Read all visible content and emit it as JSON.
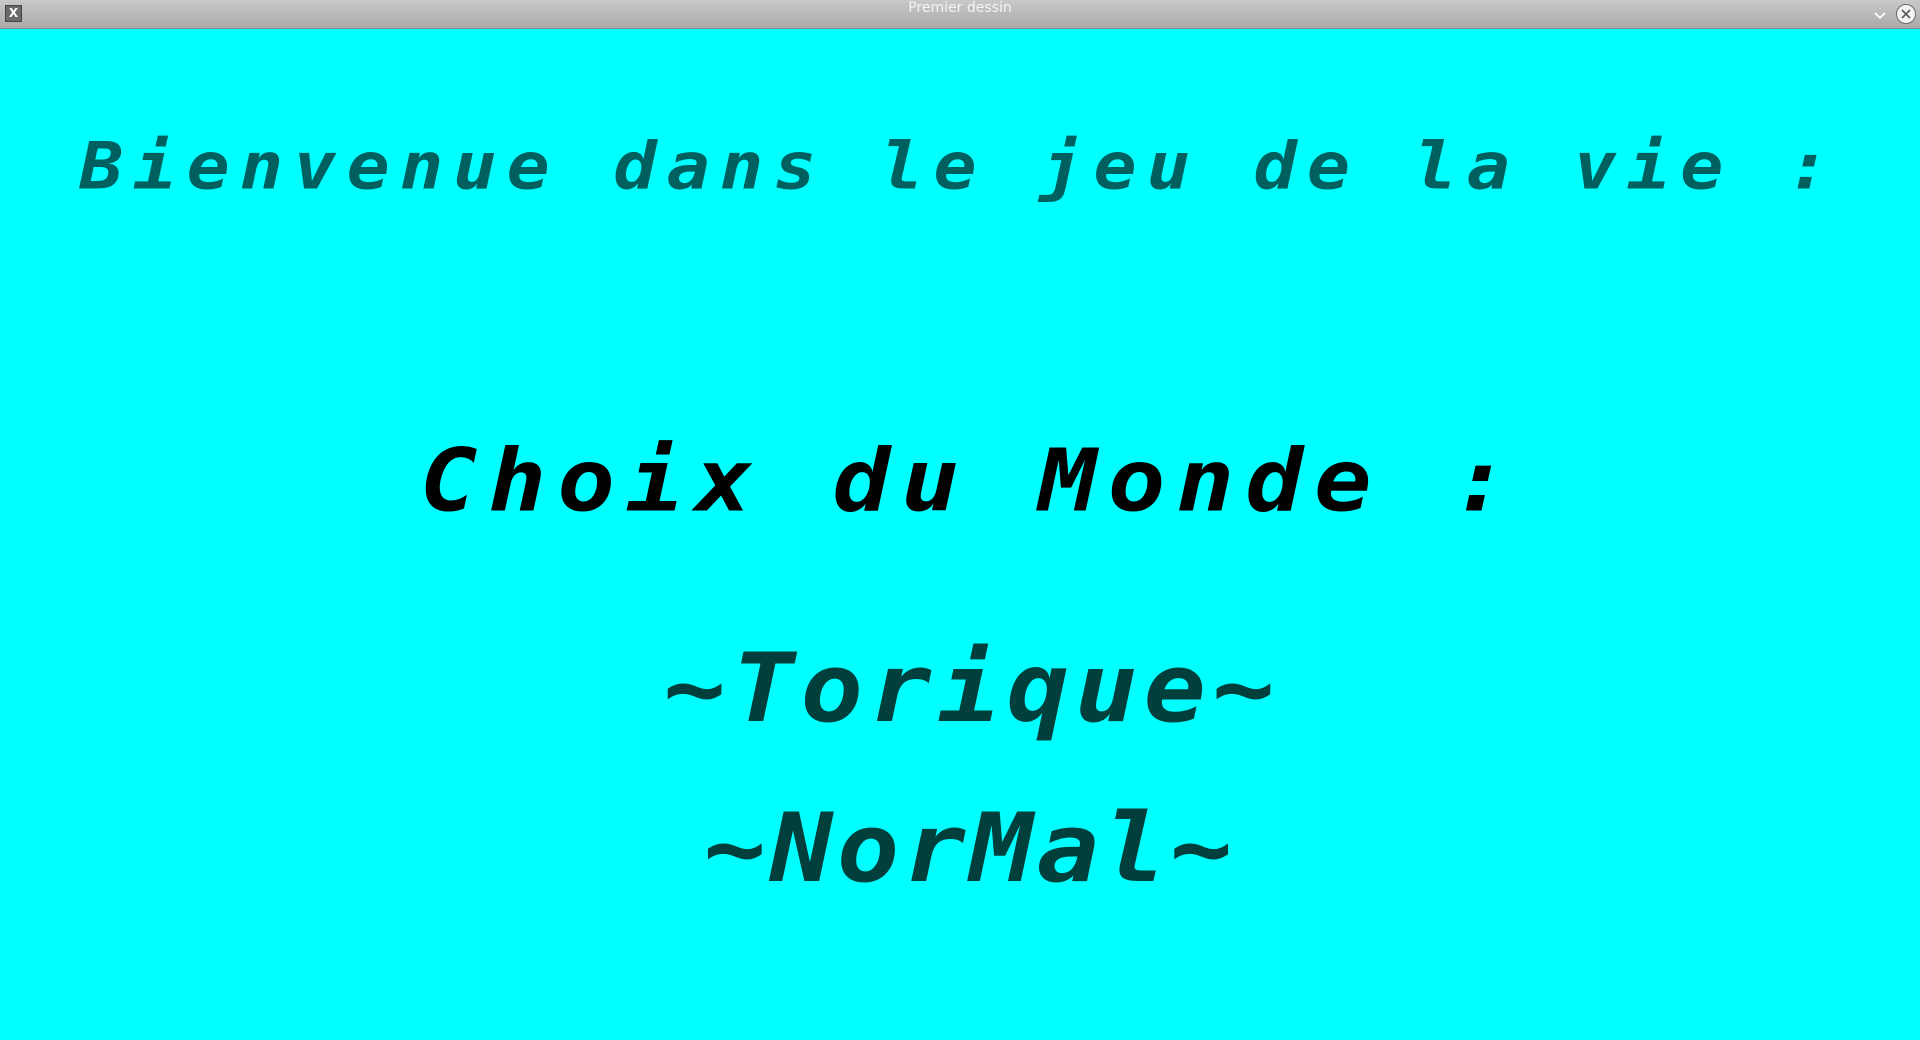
{
  "window": {
    "title": "Premier dessin",
    "background_color": "#00ffff"
  },
  "screen": {
    "welcome_text": "Bienvenue dans le jeu de la vie :",
    "prompt_text": "Choix du Monde :",
    "options": [
      {
        "label": "~Torique~"
      },
      {
        "label": "~NorMal~"
      }
    ]
  },
  "colors": {
    "welcome": "#00605f",
    "prompt": "#000000",
    "options": "#003f3c",
    "titlebar": "#b5b5b5"
  },
  "icons": {
    "app": "x-window-icon",
    "minimize": "chevron-down-icon",
    "close": "close-icon"
  }
}
